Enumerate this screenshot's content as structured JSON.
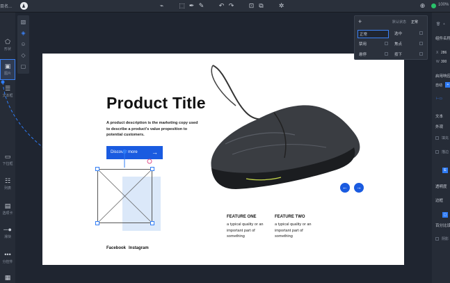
{
  "topbar": {
    "project_name": "目名...",
    "zoom": "100%"
  },
  "library": {
    "items": [
      {
        "label": "形状",
        "icon": "pentagon-icon"
      },
      {
        "label": "图片",
        "icon": "image-icon"
      },
      {
        "label": "文本框",
        "icon": "textbox-icon"
      },
      {
        "label": "下拉框",
        "icon": "dropdown-icon"
      },
      {
        "label": "列表",
        "icon": "list-icon"
      },
      {
        "label": "选项卡",
        "icon": "tabs-icon"
      },
      {
        "label": "滑块",
        "icon": "slider-icon"
      },
      {
        "label": "分控件",
        "icon": "more-icon"
      }
    ]
  },
  "canvas": {
    "title": "Product Title",
    "description": "A product description is the marketing copy used to describe a product's value propesition to potential customers.",
    "cta_label": "Discover more",
    "social": [
      "Facebook",
      "Instagram"
    ],
    "features": [
      {
        "title": "FEATURE ONE",
        "desc": "a typical quality or an important part of something"
      },
      {
        "title": "FEATURE TWO",
        "desc": "a typical quality or an important part of something"
      }
    ]
  },
  "popup": {
    "default_label": "默认状态",
    "default_value": "正常",
    "states": [
      "正常",
      "选中",
      "禁用",
      "焦点",
      "悬停",
      "按下"
    ]
  },
  "props": {
    "component_name": "组件名称",
    "x_label": "X",
    "x_value": "286",
    "w_label": "W",
    "w_value": "300",
    "enable_response": "启用响应",
    "auto": "自动",
    "text": "文本",
    "appearance": "外观",
    "fill": "填充",
    "stroke": "描边",
    "opacity": "透明度",
    "border": "边框",
    "percent": "百分比设置",
    "shadow": "阴影"
  },
  "colors": {
    "accent": "#2f7cf6",
    "cta": "#1a5be0",
    "status": "#29c26a"
  }
}
